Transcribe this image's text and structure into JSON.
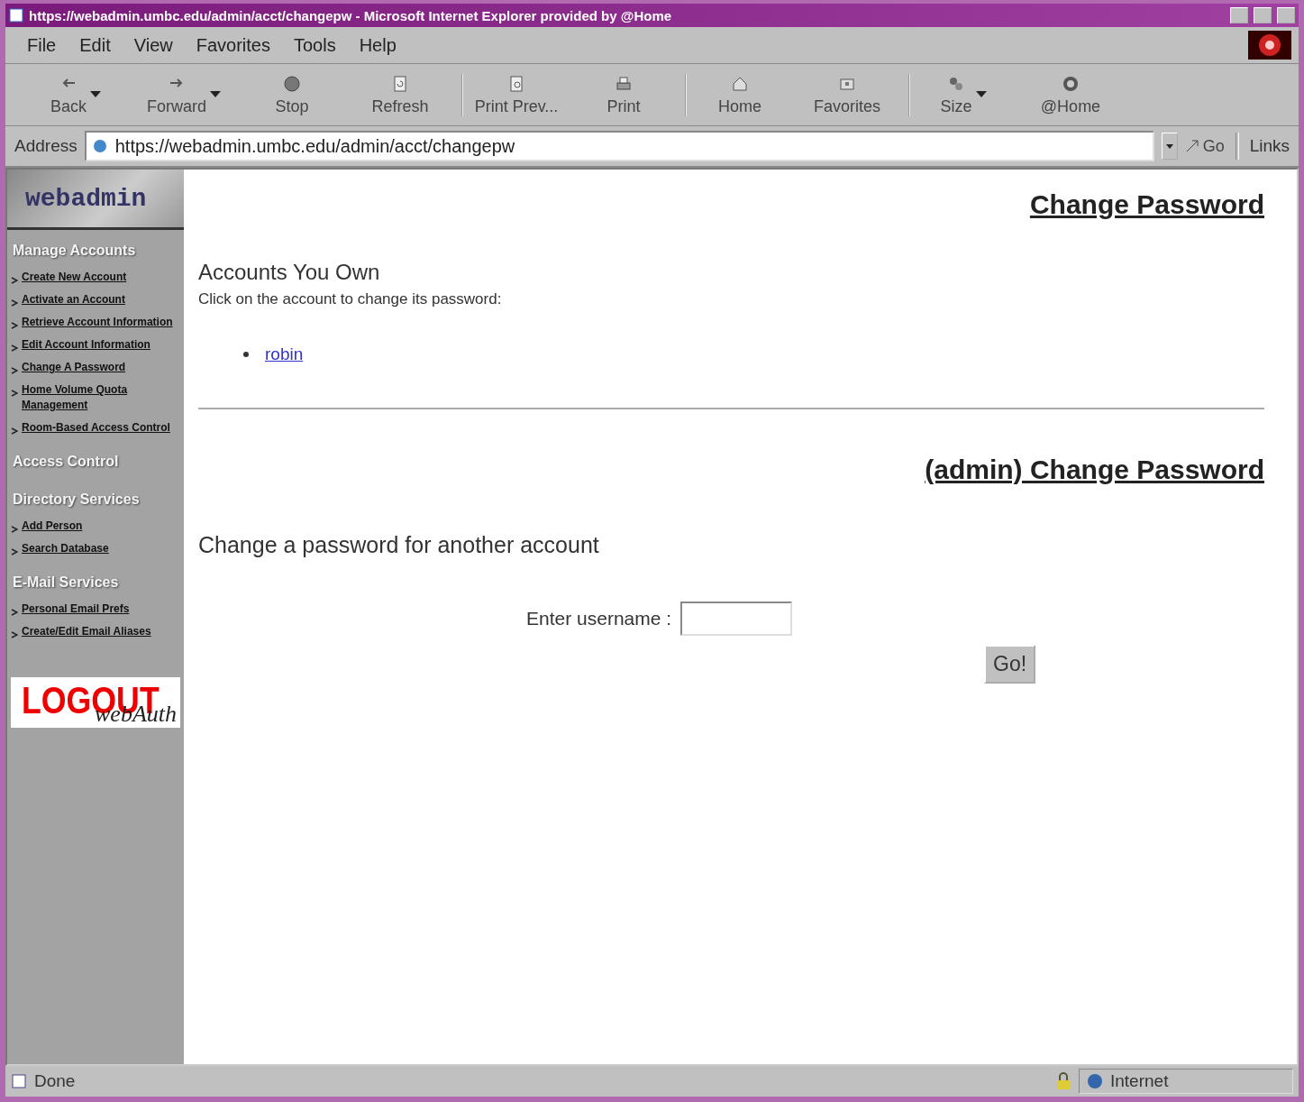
{
  "window": {
    "title": "https://webadmin.umbc.edu/admin/acct/changepw - Microsoft Internet Explorer provided by @Home"
  },
  "menu": [
    "File",
    "Edit",
    "View",
    "Favorites",
    "Tools",
    "Help"
  ],
  "toolbar": [
    {
      "label": "Back",
      "has_menu": true,
      "separator_before": false
    },
    {
      "label": "Forward",
      "has_menu": true,
      "separator_before": false
    },
    {
      "label": "Stop",
      "has_menu": false,
      "separator_before": false
    },
    {
      "label": "Refresh",
      "has_menu": false,
      "separator_before": false
    },
    {
      "label": "Print Prev...",
      "has_menu": false,
      "separator_before": true
    },
    {
      "label": "Print",
      "has_menu": false,
      "separator_before": false
    },
    {
      "label": "Home",
      "has_menu": false,
      "separator_before": true
    },
    {
      "label": "Favorites",
      "has_menu": false,
      "separator_before": false
    },
    {
      "label": "Size",
      "has_menu": true,
      "separator_before": true
    },
    {
      "label": "@Home",
      "has_menu": false,
      "separator_before": false
    }
  ],
  "address_bar": {
    "label": "Address",
    "value": "https://webadmin.umbc.edu/admin/acct/changepw",
    "go": "Go",
    "links": "Links"
  },
  "sidebar": {
    "logo": "webadmin",
    "sections": [
      {
        "title": "Manage Accounts",
        "items": [
          "Create New Account",
          "Activate an Account",
          "Retrieve Account Information",
          "Edit Account Information",
          "Change A Password",
          "Home Volume Quota Management",
          "Room-Based Access Control"
        ]
      },
      {
        "title": "Access Control"
      },
      {
        "title": "Directory Services",
        "items": [
          "Add Person",
          "Search Database"
        ]
      },
      {
        "title": "E-Mail Services",
        "items": [
          "Personal Email Prefs",
          "Create/Edit Email Aliases"
        ]
      }
    ],
    "logout": {
      "label": "LOGOUT",
      "sub": "webAuth"
    }
  },
  "main": {
    "heading": "Change Password",
    "owned_title": "Accounts You Own",
    "owned_hint": "Click on the account to change its password:",
    "accounts": [
      "robin"
    ],
    "admin_heading": "(admin) Change Password",
    "admin_title": "Change a password for another account",
    "username_label": "Enter username :",
    "submit": "Go!"
  },
  "status_bar": {
    "text": "Done",
    "zone": "Internet"
  }
}
